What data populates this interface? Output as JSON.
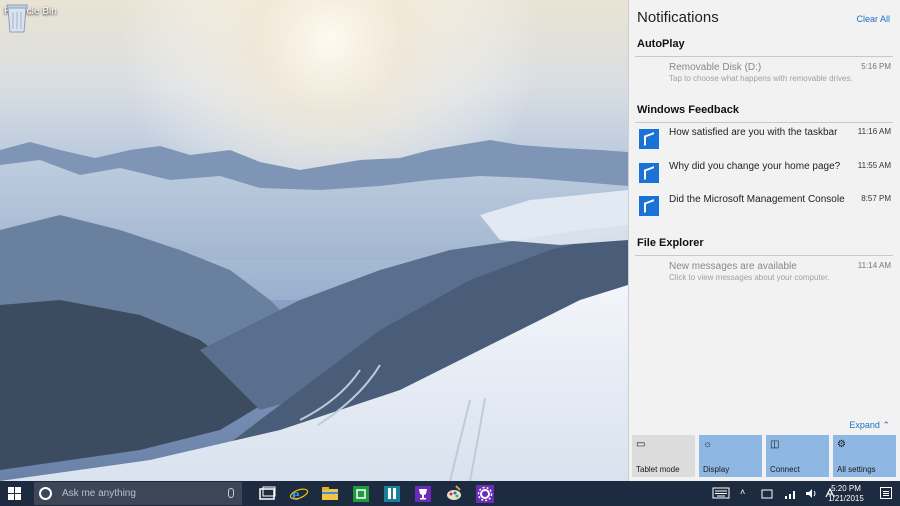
{
  "desktop": {
    "recycle_bin_label": "Recycle Bin"
  },
  "action_center": {
    "title": "Notifications",
    "clear_all": "Clear All",
    "expand": "Expand",
    "groups": [
      {
        "name": "AutoPlay",
        "items": [
          {
            "title": "Removable Disk (D:)",
            "subtitle": "Tap to choose what happens with removable drives.",
            "time": "5:16 PM",
            "icon": "none"
          }
        ]
      },
      {
        "name": "Windows Feedback",
        "items": [
          {
            "title": "How satisfied are you with the taskbar",
            "time": "11:16 AM",
            "icon": "feedback-icon"
          },
          {
            "title": "Why did you change your home page?",
            "time": "11:55 AM",
            "icon": "feedback-icon"
          },
          {
            "title": "Did the Microsoft Management Console",
            "time": "8:57 PM",
            "icon": "feedback-icon"
          }
        ]
      },
      {
        "name": "File Explorer",
        "items": [
          {
            "title": "New messages are available",
            "subtitle": "Click to view messages about your computer.",
            "time": "11:14 AM",
            "icon": "none"
          }
        ]
      }
    ],
    "quick_actions": [
      {
        "label": "Tablet mode",
        "icon": "tablet-icon",
        "state": "off"
      },
      {
        "label": "Display",
        "icon": "display-icon",
        "state": "on"
      },
      {
        "label": "Connect",
        "icon": "connect-icon",
        "state": "on"
      },
      {
        "label": "All settings",
        "icon": "settings-icon",
        "state": "on"
      }
    ]
  },
  "taskbar": {
    "search_placeholder": "Ask me anything",
    "apps": [
      "task-view-icon",
      "internet-explorer-icon",
      "file-explorer-icon",
      "store-icon",
      "calculator-icon",
      "trophy-icon",
      "paint-icon",
      "settings-app-icon"
    ],
    "time": "5:20 PM",
    "date": "1/21/2015"
  },
  "colors": {
    "accent": "#1a72d6",
    "link": "#1a6fc4",
    "taskbar": "#1c2b3f",
    "tile_on": "#8eb7e3",
    "tile_off": "#dcdcdc"
  }
}
